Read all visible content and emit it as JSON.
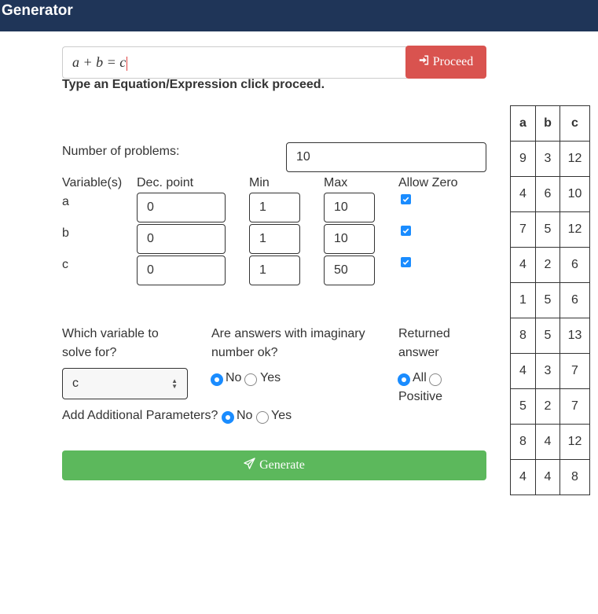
{
  "app": {
    "title": "Generator"
  },
  "equation": {
    "value": "a + b = c",
    "proceed_label": "Proceed"
  },
  "hint": "Type an Equation/Expression click proceed.",
  "num_problems": {
    "label": "Number of problems:",
    "value": "10"
  },
  "variables": {
    "headers": {
      "variable": "Variable(s)",
      "dec_point": "Dec. point",
      "min": "Min",
      "max": "Max",
      "allow_zero": "Allow Zero"
    },
    "rows": [
      {
        "name": "a",
        "dec_point": "0",
        "min": "1",
        "max": "10",
        "allow_zero": true
      },
      {
        "name": "b",
        "dec_point": "0",
        "min": "1",
        "max": "10",
        "allow_zero": true
      },
      {
        "name": "c",
        "dec_point": "0",
        "min": "1",
        "max": "50",
        "allow_zero": true
      }
    ]
  },
  "solve_for": {
    "label_line1": "Which variable to",
    "label_line2": "solve for?",
    "selected": "c"
  },
  "imaginary": {
    "label_line1": "Are answers with imaginary",
    "label_line2": "number ok?",
    "options": [
      "No",
      "Yes"
    ],
    "selected": "No"
  },
  "returned_answer": {
    "label_line1": "Returned",
    "label_line2": "answer",
    "options": [
      "All",
      "Positive"
    ],
    "selected": "All"
  },
  "additional": {
    "label": "Add Additional Parameters?",
    "options": [
      "No",
      "Yes"
    ],
    "selected": "No"
  },
  "generate_label": "Generate",
  "results": {
    "headers": [
      "a",
      "b",
      "c"
    ],
    "rows": [
      [
        "9",
        "3",
        "12"
      ],
      [
        "4",
        "6",
        "10"
      ],
      [
        "7",
        "5",
        "12"
      ],
      [
        "4",
        "2",
        "6"
      ],
      [
        "1",
        "5",
        "6"
      ],
      [
        "8",
        "5",
        "13"
      ],
      [
        "4",
        "3",
        "7"
      ],
      [
        "5",
        "2",
        "7"
      ],
      [
        "8",
        "4",
        "12"
      ],
      [
        "4",
        "4",
        "8"
      ]
    ]
  },
  "colors": {
    "navbar": "#1f3558",
    "proceed": "#d9534f",
    "generate": "#5cb85c",
    "accent": "#1a8cff"
  },
  "icons": {
    "proceed": "sign-in-icon",
    "generate": "paper-plane-icon",
    "select": "select-arrows-icon"
  }
}
